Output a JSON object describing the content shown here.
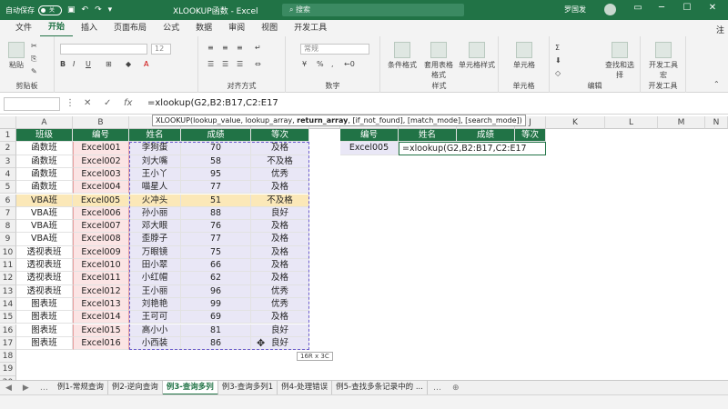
{
  "title_bar": {
    "autosave_label": "自动保存",
    "autosave_state": "关",
    "doc_title": "XLOOKUP函数 - Excel",
    "search_placeholder": "搜索",
    "user_name": "罗国发"
  },
  "ribbon_tabs": [
    "文件",
    "开始",
    "插入",
    "页面布局",
    "公式",
    "数据",
    "审阅",
    "视图",
    "开发工具"
  ],
  "ribbon_tab_right": "注",
  "ribbon_groups": {
    "clipboard": "剪贴板",
    "paste": "粘贴",
    "alignment": "对齐方式",
    "number": "数字",
    "number_format": "常规",
    "font_size": "12",
    "styles": "样式",
    "cond_format": "条件格式",
    "table_format": "套用表格格式",
    "cell_styles": "单元格样式",
    "cells": "单元格",
    "cells_btn": "单元格",
    "editing": "编辑",
    "find_select": "查找和选择",
    "dev_tools": "开发工具",
    "macro": "宏",
    "dev_tools_group": "开发工具"
  },
  "formula_bar": {
    "formula_prefix": "=xlookup(",
    "formula_args": "G2,B2:B17,C2:E17"
  },
  "tooltip": {
    "fn": "XLOOKUP(",
    "args_before": "lookup_value, lookup_array, ",
    "bold_arg": "return_array",
    "args_after": ", [if_not_found], [match_mode], [search_mode])"
  },
  "columns": [
    "A",
    "B",
    "C",
    "D",
    "E",
    "F",
    "G",
    "H",
    "I",
    "J",
    "K",
    "L",
    "M",
    "N",
    "O"
  ],
  "table": {
    "headers": [
      "班级",
      "编号",
      "姓名",
      "成绩",
      "等次"
    ],
    "rows": [
      [
        "函数班",
        "Excel001",
        "李狗蛋",
        "70",
        "及格"
      ],
      [
        "函数班",
        "Excel002",
        "刘大嘴",
        "58",
        "不及格"
      ],
      [
        "函数班",
        "Excel003",
        "王小丫",
        "95",
        "优秀"
      ],
      [
        "函数班",
        "Excel004",
        "喵星人",
        "77",
        "及格"
      ],
      [
        "VBA班",
        "Excel005",
        "火冲头",
        "51",
        "不及格"
      ],
      [
        "VBA班",
        "Excel006",
        "孙小丽",
        "88",
        "良好"
      ],
      [
        "VBA班",
        "Excel007",
        "邓大眼",
        "76",
        "及格"
      ],
      [
        "VBA班",
        "Excel008",
        "歪脖子",
        "77",
        "及格"
      ],
      [
        "透视表班",
        "Excel009",
        "万眼镜",
        "75",
        "及格"
      ],
      [
        "透视表班",
        "Excel010",
        "田小翠",
        "66",
        "及格"
      ],
      [
        "透视表班",
        "Excel011",
        "小红帽",
        "62",
        "及格"
      ],
      [
        "透视表班",
        "Excel012",
        "王小丽",
        "96",
        "优秀"
      ],
      [
        "图表班",
        "Excel013",
        "刘艳艳",
        "99",
        "优秀"
      ],
      [
        "图表班",
        "Excel014",
        "王可可",
        "69",
        "及格"
      ],
      [
        "图表班",
        "Excel015",
        "高小小",
        "81",
        "良好"
      ],
      [
        "图表班",
        "Excel016",
        "小西装",
        "86",
        "良好"
      ]
    ]
  },
  "lookup": {
    "headers": [
      "编号",
      "姓名",
      "成绩",
      "等次"
    ],
    "value": "Excel005",
    "formula": "=xlookup(G2,B2:B17,C2:E17"
  },
  "row_numbers": [
    "1",
    "2",
    "3",
    "4",
    "5",
    "6",
    "7",
    "8",
    "9",
    "10",
    "11",
    "12",
    "13",
    "14",
    "15",
    "16",
    "17",
    "18",
    "19",
    "20"
  ],
  "selection_size": "16R x 3C",
  "sheet_tabs": [
    "例1-常规查询",
    "例2-逆向查询",
    "例3-查询多列",
    "例3-查询多列1",
    "例4-处理错误",
    "例5-查找多条记录中的 ..."
  ],
  "active_sheet_index": 2,
  "colors": {
    "accent": "#217346",
    "highlight_row": "#fbe8b8",
    "ref_blue": "#e9e7f6",
    "ref_red": "#fbe4e4"
  }
}
